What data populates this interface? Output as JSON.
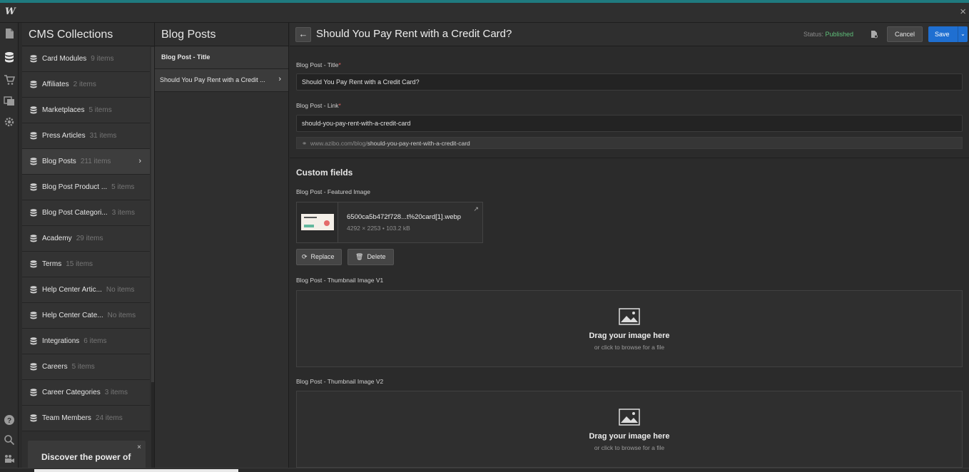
{
  "app": {
    "logo": "W",
    "close_icon": "×"
  },
  "rail": {
    "icons": [
      "pages-icon",
      "cms-icon",
      "ecommerce-icon",
      "assets-icon",
      "settings-icon",
      "help-icon",
      "search-icon",
      "video-icon"
    ]
  },
  "cms": {
    "title": "CMS Collections",
    "collections": [
      {
        "name": "Card Modules",
        "count": "9 items"
      },
      {
        "name": "Affiliates",
        "count": "2 items"
      },
      {
        "name": "Marketplaces",
        "count": "5 items"
      },
      {
        "name": "Press Articles",
        "count": "31 items"
      },
      {
        "name": "Blog Posts",
        "count": "211 items"
      },
      {
        "name": "Blog Post Product ...",
        "count": "5 items"
      },
      {
        "name": "Blog Post Categori...",
        "count": "3 items"
      },
      {
        "name": "Academy",
        "count": "29 items"
      },
      {
        "name": "Terms",
        "count": "15 items"
      },
      {
        "name": "Help Center Artic...",
        "count": "No items"
      },
      {
        "name": "Help Center Cate...",
        "count": "No items"
      },
      {
        "name": "Integrations",
        "count": "6 items"
      },
      {
        "name": "Careers",
        "count": "5 items"
      },
      {
        "name": "Career Categories",
        "count": "3 items"
      },
      {
        "name": "Team Members",
        "count": "24 items"
      }
    ],
    "active_index": 4,
    "promo_text": "Discover the power of",
    "promo_close": "×"
  },
  "posts": {
    "title": "Blog Posts",
    "column_header": "Blog Post - Title",
    "items": [
      "Should You Pay Rent with a Credit ..."
    ]
  },
  "editor": {
    "title": "Should You Pay Rent with a Credit Card?",
    "status_label": "Status:",
    "status_value": "Published",
    "cancel_label": "Cancel",
    "save_label": "Save",
    "title_field_label": "Blog Post - Title",
    "title_value": "Should You Pay Rent with a Credit Card?",
    "link_field_label": "Blog Post - Link",
    "link_value": "should-you-pay-rent-with-a-credit-card",
    "url_prefix": "www.azibo.com/blog/",
    "url_slug": "should-you-pay-rent-with-a-credit-card",
    "required_mark": "*",
    "custom_fields_title": "Custom fields",
    "featured_label": "Blog Post - Featured Image",
    "featured_file": "6500ca5b472f728...t%20card[1].webp",
    "featured_meta": "4292 × 2253 • 103.2 kB",
    "replace_label": "Replace",
    "delete_label": "Delete",
    "thumb_v1_label": "Blog Post - Thumbnail Image V1",
    "thumb_v2_label": "Blog Post - Thumbnail Image V2",
    "drop_title": "Drag your image here",
    "drop_sub": "or click to browse for a file"
  },
  "colors": {
    "accent": "#1f7a7f",
    "save": "#1f6fd1",
    "published": "#5fbf7a",
    "required": "#e35d5d"
  }
}
